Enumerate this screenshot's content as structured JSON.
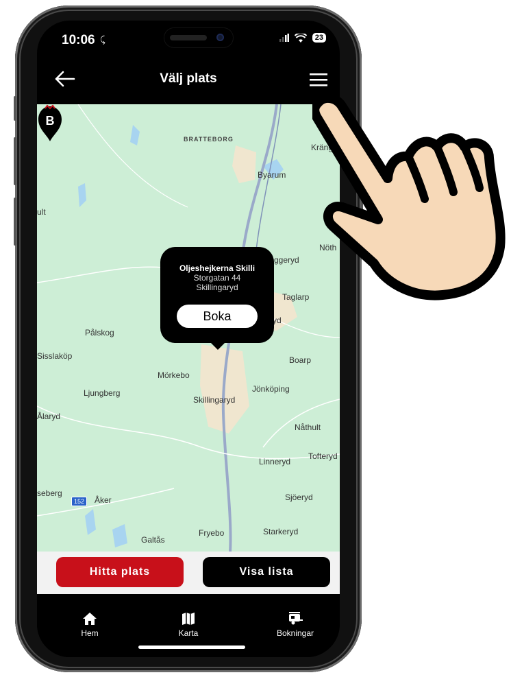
{
  "status": {
    "time": "10:06",
    "battery": "23"
  },
  "appbar": {
    "title": "Välj plats",
    "back_icon": "arrow-left-icon",
    "menu_icon": "hamburger-menu-icon"
  },
  "map": {
    "places": {
      "bratteborg": "BRATTEBORG",
      "krangs": "Krängs",
      "byarum": "Byarum",
      "ult": "ult",
      "nothult": "Nöth",
      "vaggeryd": "ggeryd",
      "taglarp": "Taglarp",
      "vd": "yd",
      "palskog": "Pålskog",
      "sisslakop": "Sisslaköp",
      "boarp": "Boarp",
      "morkebo": "Mörkebo",
      "jonkoping": "Jönköping",
      "ljungberg": "Ljungberg",
      "skillingaryd": "Skillingaryd",
      "alaryd": "Ålaryd",
      "nathult": "Nåthult",
      "linneryd": "Linneryd",
      "tofteryd": "Tofteryd",
      "seberg": "seberg",
      "aker": "Åker",
      "sjoeryd": "Sjöeryd",
      "galtas": "Galtås",
      "fryebo": "Fryebo",
      "starkeryd": "Starkeryd"
    },
    "route_shield": "152",
    "colors": {
      "land": "#cdeed6",
      "road": "#9aa9c9",
      "urban": "#f0e6cf",
      "water": "#a8d4f0"
    }
  },
  "popup": {
    "name": "Oljeshejkerna Skilli",
    "street": "Storgatan 44",
    "city": "Skillingaryd",
    "book_label": "Boka"
  },
  "pin": {
    "letter": "B"
  },
  "actions": {
    "find_label": "Hitta plats",
    "list_label": "Visa lista"
  },
  "tabs": {
    "home": "Hem",
    "map": "Karta",
    "bookings": "Bokningar"
  },
  "colors": {
    "accent_red": "#c8101a",
    "black": "#000000"
  }
}
